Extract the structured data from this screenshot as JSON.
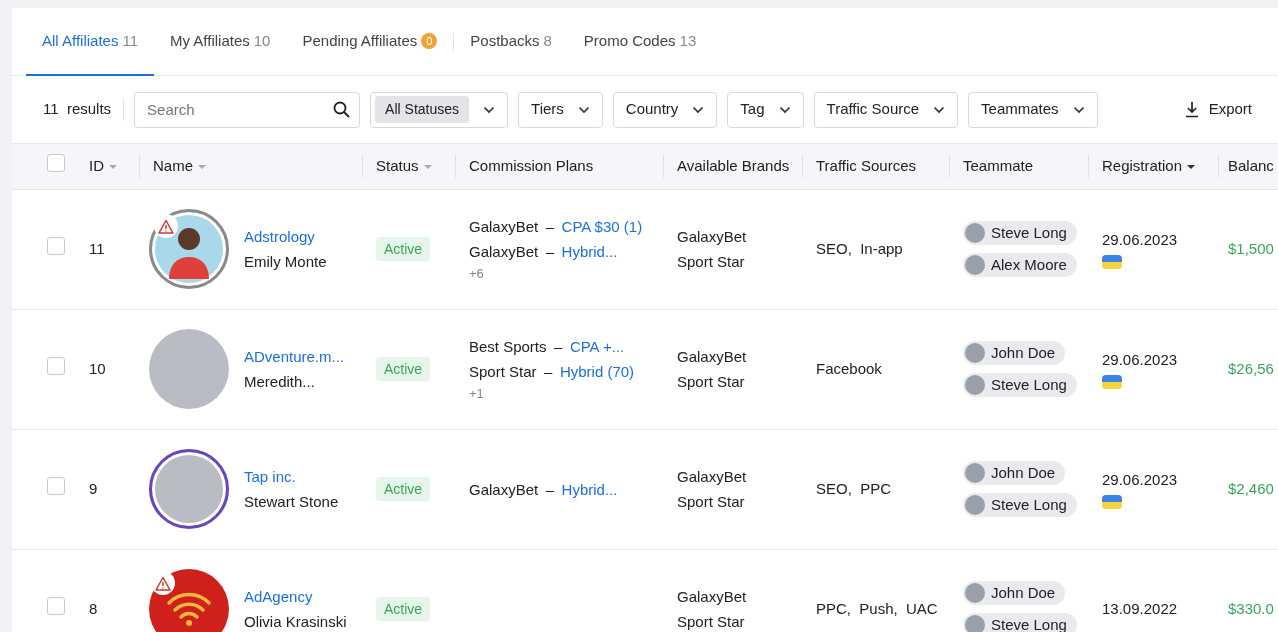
{
  "tabs": [
    {
      "label": "All Affiliates",
      "count": "11",
      "kind": "count",
      "selected": true
    },
    {
      "label": "My Affiliates",
      "count": "10",
      "kind": "count",
      "selected": false
    },
    {
      "label": "Pending Affiliates",
      "count": "0",
      "kind": "badge",
      "selected": false
    },
    {
      "label": "Postbacks",
      "count": "8",
      "kind": "count",
      "selected": false
    },
    {
      "label": "Promo Codes",
      "count": "13",
      "kind": "count",
      "selected": false
    }
  ],
  "toolbar": {
    "results_count": "11",
    "results_label": "results",
    "search": {
      "placeholder": "Search"
    },
    "filters": [
      {
        "label": "All Statuses",
        "kind": "chip"
      },
      {
        "label": "Tiers",
        "kind": "plain"
      },
      {
        "label": "Country",
        "kind": "plain"
      },
      {
        "label": "Tag",
        "kind": "plain"
      },
      {
        "label": "Traffic Source",
        "kind": "plain"
      },
      {
        "label": "Teammates",
        "kind": "plain"
      }
    ],
    "export": "Export"
  },
  "table": {
    "select_all": {
      "checked": false
    },
    "columns": [
      {
        "label": "ID",
        "sortable": true,
        "sorted": false
      },
      {
        "label": "Name",
        "sortable": true,
        "sorted": false
      },
      {
        "label": "Status",
        "sortable": true,
        "sorted": false
      },
      {
        "label": "Commission Plans",
        "sortable": false,
        "sorted": false
      },
      {
        "label": "Available Brands",
        "sortable": false,
        "sorted": false
      },
      {
        "label": "Traffic Sources",
        "sortable": false,
        "sorted": false
      },
      {
        "label": "Teammate",
        "sortable": false,
        "sorted": false
      },
      {
        "label": "Registration",
        "sortable": true,
        "sorted": true
      },
      {
        "label": "Balanc",
        "sortable": false,
        "sorted": false
      }
    ],
    "rows": [
      {
        "checked": false,
        "id": "11",
        "avatar": {
          "kind": "illustration",
          "color": "#8a8a8a",
          "warning": true
        },
        "company": "Adstrology",
        "contact": "Emily Monte",
        "status": "Active",
        "plans": [
          {
            "brand": "GalaxyBet",
            "sep": "–",
            "plan": "CPA $30 (1)"
          },
          {
            "brand": "GalaxyBet",
            "sep": "–",
            "plan": "Hybrid..."
          }
        ],
        "more": "+6",
        "brands": [
          "GalaxyBet",
          "Sport Star"
        ],
        "traffic": "SEO,  In-app",
        "teammates": [
          "Steve Long",
          "Alex Moore"
        ],
        "registration": "29.06.2023",
        "flag": true,
        "balance": "$1,500"
      },
      {
        "checked": false,
        "id": "10",
        "avatar": {
          "kind": "photo",
          "warning": false
        },
        "company": "ADventure.m...",
        "contact": "Meredith...",
        "status": "Active",
        "plans": [
          {
            "brand": "Best Sports",
            "sep": "–",
            "plan": "CPA +..."
          },
          {
            "brand": "Sport Star",
            "sep": "–",
            "plan": "Hybrid (70)"
          }
        ],
        "more": "+1",
        "brands": [
          "GalaxyBet",
          "Sport Star"
        ],
        "traffic": "Facebook",
        "teammates": [
          "John Doe",
          "Steve Long"
        ],
        "registration": "29.06.2023",
        "flag": true,
        "balance": "$26,56"
      },
      {
        "checked": false,
        "id": "9",
        "avatar": {
          "kind": "photo",
          "color": "#6a45c2",
          "warning": false
        },
        "company": "Tap inc.",
        "contact": "Stewart Stone",
        "status": "Active",
        "plans": [
          {
            "brand": "GalaxyBet",
            "sep": "–",
            "plan": "Hybrid..."
          }
        ],
        "brands": [
          "GalaxyBet",
          "Sport Star"
        ],
        "traffic": "SEO,  PPC",
        "teammates": [
          "John Doe",
          "Steve Long"
        ],
        "registration": "29.06.2023",
        "flag": true,
        "balance": "$2,460"
      },
      {
        "checked": false,
        "id": "8",
        "avatar": {
          "kind": "logo",
          "warning": true
        },
        "company": "AdAgency",
        "contact": "Olivia Krasinski",
        "status": "Active",
        "plans": [],
        "brands": [
          "GalaxyBet",
          "Sport Star"
        ],
        "traffic": "PPC,  Push,  UAC",
        "teammates": [
          "John Doe",
          "Steve Long"
        ],
        "registration": "13.09.2022",
        "flag": false,
        "balance": "$330.0"
      }
    ]
  }
}
